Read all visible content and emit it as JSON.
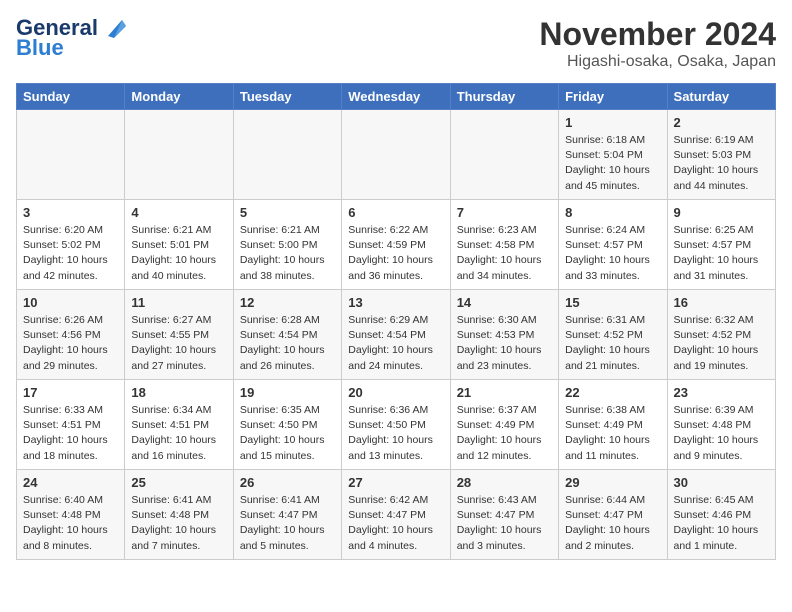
{
  "header": {
    "logo_general": "General",
    "logo_blue": "Blue",
    "title": "November 2024",
    "subtitle": "Higashi-osaka, Osaka, Japan"
  },
  "calendar": {
    "days_of_week": [
      "Sunday",
      "Monday",
      "Tuesday",
      "Wednesday",
      "Thursday",
      "Friday",
      "Saturday"
    ],
    "weeks": [
      [
        {
          "day": "",
          "detail": ""
        },
        {
          "day": "",
          "detail": ""
        },
        {
          "day": "",
          "detail": ""
        },
        {
          "day": "",
          "detail": ""
        },
        {
          "day": "",
          "detail": ""
        },
        {
          "day": "1",
          "detail": "Sunrise: 6:18 AM\nSunset: 5:04 PM\nDaylight: 10 hours\nand 45 minutes."
        },
        {
          "day": "2",
          "detail": "Sunrise: 6:19 AM\nSunset: 5:03 PM\nDaylight: 10 hours\nand 44 minutes."
        }
      ],
      [
        {
          "day": "3",
          "detail": "Sunrise: 6:20 AM\nSunset: 5:02 PM\nDaylight: 10 hours\nand 42 minutes."
        },
        {
          "day": "4",
          "detail": "Sunrise: 6:21 AM\nSunset: 5:01 PM\nDaylight: 10 hours\nand 40 minutes."
        },
        {
          "day": "5",
          "detail": "Sunrise: 6:21 AM\nSunset: 5:00 PM\nDaylight: 10 hours\nand 38 minutes."
        },
        {
          "day": "6",
          "detail": "Sunrise: 6:22 AM\nSunset: 4:59 PM\nDaylight: 10 hours\nand 36 minutes."
        },
        {
          "day": "7",
          "detail": "Sunrise: 6:23 AM\nSunset: 4:58 PM\nDaylight: 10 hours\nand 34 minutes."
        },
        {
          "day": "8",
          "detail": "Sunrise: 6:24 AM\nSunset: 4:57 PM\nDaylight: 10 hours\nand 33 minutes."
        },
        {
          "day": "9",
          "detail": "Sunrise: 6:25 AM\nSunset: 4:57 PM\nDaylight: 10 hours\nand 31 minutes."
        }
      ],
      [
        {
          "day": "10",
          "detail": "Sunrise: 6:26 AM\nSunset: 4:56 PM\nDaylight: 10 hours\nand 29 minutes."
        },
        {
          "day": "11",
          "detail": "Sunrise: 6:27 AM\nSunset: 4:55 PM\nDaylight: 10 hours\nand 27 minutes."
        },
        {
          "day": "12",
          "detail": "Sunrise: 6:28 AM\nSunset: 4:54 PM\nDaylight: 10 hours\nand 26 minutes."
        },
        {
          "day": "13",
          "detail": "Sunrise: 6:29 AM\nSunset: 4:54 PM\nDaylight: 10 hours\nand 24 minutes."
        },
        {
          "day": "14",
          "detail": "Sunrise: 6:30 AM\nSunset: 4:53 PM\nDaylight: 10 hours\nand 23 minutes."
        },
        {
          "day": "15",
          "detail": "Sunrise: 6:31 AM\nSunset: 4:52 PM\nDaylight: 10 hours\nand 21 minutes."
        },
        {
          "day": "16",
          "detail": "Sunrise: 6:32 AM\nSunset: 4:52 PM\nDaylight: 10 hours\nand 19 minutes."
        }
      ],
      [
        {
          "day": "17",
          "detail": "Sunrise: 6:33 AM\nSunset: 4:51 PM\nDaylight: 10 hours\nand 18 minutes."
        },
        {
          "day": "18",
          "detail": "Sunrise: 6:34 AM\nSunset: 4:51 PM\nDaylight: 10 hours\nand 16 minutes."
        },
        {
          "day": "19",
          "detail": "Sunrise: 6:35 AM\nSunset: 4:50 PM\nDaylight: 10 hours\nand 15 minutes."
        },
        {
          "day": "20",
          "detail": "Sunrise: 6:36 AM\nSunset: 4:50 PM\nDaylight: 10 hours\nand 13 minutes."
        },
        {
          "day": "21",
          "detail": "Sunrise: 6:37 AM\nSunset: 4:49 PM\nDaylight: 10 hours\nand 12 minutes."
        },
        {
          "day": "22",
          "detail": "Sunrise: 6:38 AM\nSunset: 4:49 PM\nDaylight: 10 hours\nand 11 minutes."
        },
        {
          "day": "23",
          "detail": "Sunrise: 6:39 AM\nSunset: 4:48 PM\nDaylight: 10 hours\nand 9 minutes."
        }
      ],
      [
        {
          "day": "24",
          "detail": "Sunrise: 6:40 AM\nSunset: 4:48 PM\nDaylight: 10 hours\nand 8 minutes."
        },
        {
          "day": "25",
          "detail": "Sunrise: 6:41 AM\nSunset: 4:48 PM\nDaylight: 10 hours\nand 7 minutes."
        },
        {
          "day": "26",
          "detail": "Sunrise: 6:41 AM\nSunset: 4:47 PM\nDaylight: 10 hours\nand 5 minutes."
        },
        {
          "day": "27",
          "detail": "Sunrise: 6:42 AM\nSunset: 4:47 PM\nDaylight: 10 hours\nand 4 minutes."
        },
        {
          "day": "28",
          "detail": "Sunrise: 6:43 AM\nSunset: 4:47 PM\nDaylight: 10 hours\nand 3 minutes."
        },
        {
          "day": "29",
          "detail": "Sunrise: 6:44 AM\nSunset: 4:47 PM\nDaylight: 10 hours\nand 2 minutes."
        },
        {
          "day": "30",
          "detail": "Sunrise: 6:45 AM\nSunset: 4:46 PM\nDaylight: 10 hours\nand 1 minute."
        }
      ]
    ]
  }
}
